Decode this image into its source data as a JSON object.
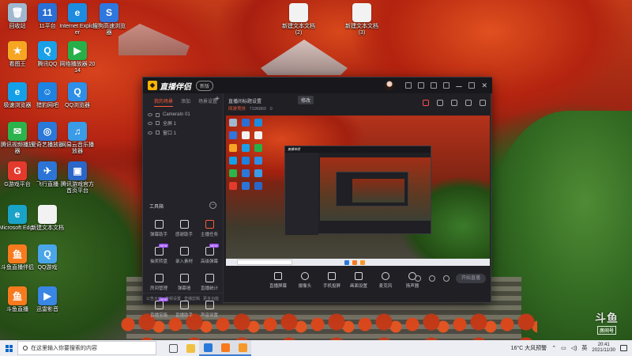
{
  "desktop": {
    "icons": [
      {
        "label": "回收站",
        "color": "#9fb8cf",
        "glyph": "🗑"
      },
      {
        "label": "11平台",
        "color": "#2a6fd6",
        "glyph": "11"
      },
      {
        "label": "Internet Explorer",
        "color": "#1c8be0",
        "glyph": "e"
      },
      {
        "label": "搜狗高速浏览器",
        "color": "#2f76de",
        "glyph": "S"
      },
      {
        "label": "新建文本文档 (2)",
        "color": "#f2f2f2",
        "glyph": ""
      },
      {
        "label": "新建文本文档 (3)",
        "color": "#f2f2f2",
        "glyph": ""
      },
      {
        "label": "看图王",
        "color": "#f6a623",
        "glyph": "★"
      },
      {
        "label": "腾讯QQ",
        "color": "#1aa0e8",
        "glyph": "Q"
      },
      {
        "label": "网络播放器 2014",
        "color": "#27b04a",
        "glyph": "▶"
      },
      {
        "label": "极速浏览器",
        "color": "#14a0e8",
        "glyph": "e"
      },
      {
        "label": "猎豹网吧",
        "color": "#1e82e0",
        "glyph": "☺"
      },
      {
        "label": "QQ浏览器",
        "color": "#2e8fe8",
        "glyph": "Q"
      },
      {
        "label": "腾讯视频播放器",
        "color": "#2cb34b",
        "glyph": "✉"
      },
      {
        "label": "爱奇艺播放器",
        "color": "#2a78d8",
        "glyph": "◎"
      },
      {
        "label": "网易云音乐播放器",
        "color": "#3a9be6",
        "glyph": "♫"
      },
      {
        "label": "G游戏平台",
        "color": "#e43a2e",
        "glyph": "G"
      },
      {
        "label": "飞行直播",
        "color": "#2c74d6",
        "glyph": "✈"
      },
      {
        "label": "腾讯游戏官方首页平台",
        "color": "#2b66c9",
        "glyph": "▣"
      },
      {
        "label": "Microsoft Edge",
        "color": "#1aa3c8",
        "glyph": "e"
      },
      {
        "label": "新建文本文档",
        "color": "#f2f2f2",
        "glyph": ""
      },
      {
        "label": "斗鱼直播伴侣",
        "color": "#f77b1e",
        "glyph": "鱼"
      },
      {
        "label": "QQ游戏",
        "color": "#4aa6e8",
        "glyph": "Q"
      },
      {
        "label": "斗鱼直播",
        "color": "#f77b1e",
        "glyph": "鱼"
      },
      {
        "label": "迅雷影音",
        "color": "#3a86e4",
        "glyph": "▶"
      }
    ]
  },
  "app": {
    "title": "直播伴侣",
    "version_badge": "新版",
    "side_tabs": [
      "我的场景",
      "添加",
      "场景设置"
    ],
    "scenes": [
      "CameraIn 01",
      "全屏 1",
      "窗口 1"
    ],
    "toolbox_title": "工具箱",
    "tools": [
      {
        "label": "弹幕助手",
        "hot": false,
        "tag": ""
      },
      {
        "label": "感谢助手",
        "hot": false,
        "tag": ""
      },
      {
        "label": "主播任务",
        "hot": true,
        "tag": ""
      },
      {
        "label": "抽奖转盘",
        "hot": false,
        "tag": "NEW"
      },
      {
        "label": "录入素材",
        "hot": false,
        "tag": ""
      },
      {
        "label": "高级弹幕",
        "hot": false,
        "tag": "NEW"
      },
      {
        "label": "房间管理",
        "hot": false,
        "tag": ""
      },
      {
        "label": "弹幕墙",
        "hot": false,
        "tag": ""
      },
      {
        "label": "直播统计",
        "hot": false,
        "tag": ""
      },
      {
        "label": "直播宝箱",
        "hot": false,
        "tag": "NEW"
      },
      {
        "label": "直播助手",
        "hot": false,
        "tag": ""
      },
      {
        "label": "声音设置",
        "hot": false,
        "tag": ""
      }
    ],
    "side_footer": [
      "公告大厅",
      "音频设置",
      "直播剪辑",
      "更多功能"
    ],
    "stream_title": "直播间标题设置",
    "edit_label": "修改",
    "meta_category": "网游竞技",
    "meta_room": "7196860",
    "meta_online": "0",
    "controls": [
      {
        "label": "直播屏幕",
        "round": false
      },
      {
        "label": "摄像头",
        "round": true
      },
      {
        "label": "手机投屏",
        "round": false
      },
      {
        "label": "画面设置",
        "round": false
      },
      {
        "label": "麦克风",
        "round": true
      },
      {
        "label": "扬声器",
        "round": true
      }
    ],
    "go_live": "开始直播"
  },
  "taskbar": {
    "search_placeholder": "在这里输入你要搜索的内容",
    "weather": "16°C 大风预警",
    "ime": "英",
    "time": "20:41",
    "date": "2021/11/30",
    "apps": [
      {
        "name": "task-view",
        "color": "#555"
      },
      {
        "name": "file-explorer",
        "color": "#f0c040"
      },
      {
        "name": "k-app",
        "color": "#2a79d8"
      },
      {
        "name": "douyu-companion",
        "color": "#f77b1e"
      },
      {
        "name": "douyu-app",
        "color": "#f59a2a"
      }
    ]
  },
  "watermark": {
    "big": "斗鱼",
    "small": "房间号"
  }
}
